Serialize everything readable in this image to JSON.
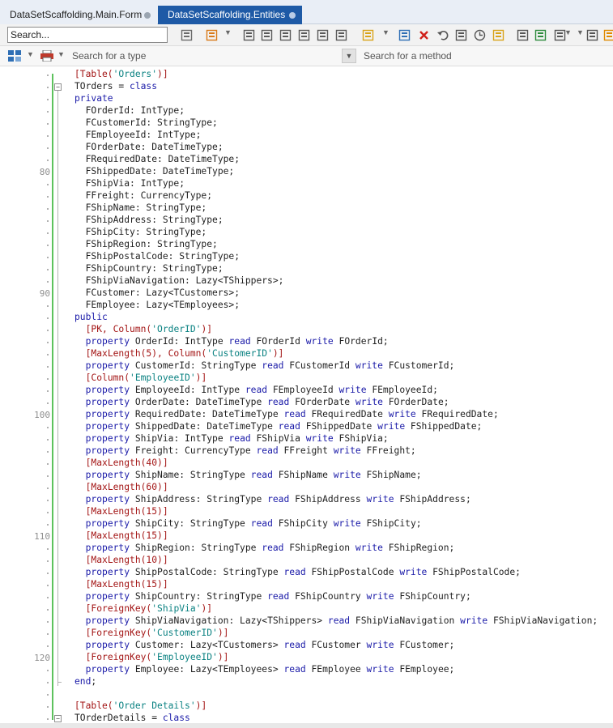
{
  "tabs": [
    {
      "label": "DataSetScaffolding.Main.Form",
      "active": false
    },
    {
      "label": "DataSetScaffolding.Entities",
      "active": true
    }
  ],
  "toolbar": {
    "search_placeholder": "Search...",
    "icons": [
      "code-template-icon",
      "add-component-icon",
      "method-icon",
      "field-icon",
      "property-icon",
      "class-icon",
      "event-icon",
      "refactor-icon",
      "bag-icon",
      "align-icon",
      "delete-icon",
      "undo-icon",
      "structure-icon",
      "history-icon",
      "edit-icon",
      "view-icon",
      "module-icon",
      "shield-icon",
      "package-icon",
      "extra-icon"
    ]
  },
  "navbar": {
    "type_placeholder": "Search for a type",
    "method_placeholder": "Search for a method"
  },
  "colors": {
    "keyword": "#1a1aa8",
    "string": "#0b8282",
    "attribute": "#a31515",
    "active_tab": "#1e5aa6",
    "change_bar": "#5dc25d"
  },
  "editor": {
    "line_numbers": [
      "80",
      "90",
      "100",
      "110",
      "120"
    ],
    "code_lines": [
      "[Table('Orders')]",
      "TOrders = class",
      "private",
      "  FOrderId: IntType;",
      "  FCustomerId: StringType;",
      "  FEmployeeId: IntType;",
      "  FOrderDate: DateTimeType;",
      "  FRequiredDate: DateTimeType;",
      "  FShippedDate: DateTimeType;",
      "  FShipVia: IntType;",
      "  FFreight: CurrencyType;",
      "  FShipName: StringType;",
      "  FShipAddress: StringType;",
      "  FShipCity: StringType;",
      "  FShipRegion: StringType;",
      "  FShipPostalCode: StringType;",
      "  FShipCountry: StringType;",
      "  FShipViaNavigation: Lazy<TShippers>;",
      "  FCustomer: Lazy<TCustomers>;",
      "  FEmployee: Lazy<TEmployees>;",
      "public",
      "  [PK, Column('OrderID')]",
      "  property OrderId: IntType read FOrderId write FOrderId;",
      "  [MaxLength(5), Column('CustomerID')]",
      "  property CustomerId: StringType read FCustomerId write FCustomerId;",
      "  [Column('EmployeeID')]",
      "  property EmployeeId: IntType read FEmployeeId write FEmployeeId;",
      "  property OrderDate: DateTimeType read FOrderDate write FOrderDate;",
      "  property RequiredDate: DateTimeType read FRequiredDate write FRequiredDate;",
      "  property ShippedDate: DateTimeType read FShippedDate write FShippedDate;",
      "  property ShipVia: IntType read FShipVia write FShipVia;",
      "  property Freight: CurrencyType read FFreight write FFreight;",
      "  [MaxLength(40)]",
      "  property ShipName: StringType read FShipName write FShipName;",
      "  [MaxLength(60)]",
      "  property ShipAddress: StringType read FShipAddress write FShipAddress;",
      "  [MaxLength(15)]",
      "  property ShipCity: StringType read FShipCity write FShipCity;",
      "  [MaxLength(15)]",
      "  property ShipRegion: StringType read FShipRegion write FShipRegion;",
      "  [MaxLength(10)]",
      "  property ShipPostalCode: StringType read FShipPostalCode write FShipPostalCode;",
      "  [MaxLength(15)]",
      "  property ShipCountry: StringType read FShipCountry write FShipCountry;",
      "  [ForeignKey('ShipVia')]",
      "  property ShipViaNavigation: Lazy<TShippers> read FShipViaNavigation write FShipViaNavigation;",
      "  [ForeignKey('CustomerID')]",
      "  property Customer: Lazy<TCustomers> read FCustomer write FCustomer;",
      "  [ForeignKey('EmployeeID')]",
      "  property Employee: Lazy<TEmployees> read FEmployee write FEmployee;",
      "end;",
      "",
      "[Table('Order Details')]",
      "TOrderDetails = class"
    ]
  }
}
